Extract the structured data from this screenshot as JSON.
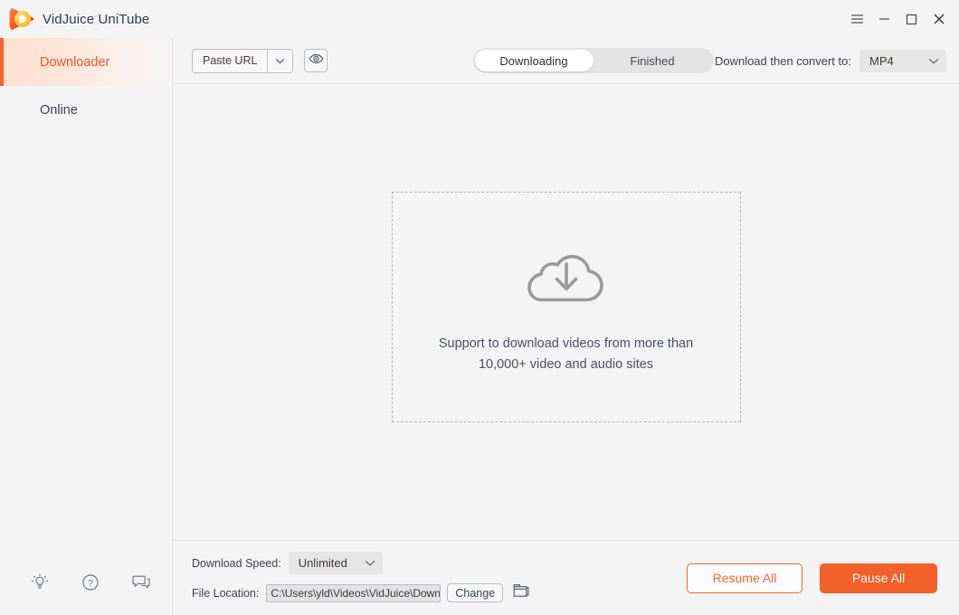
{
  "window": {
    "title": "VidJuice UniTube",
    "controls": [
      {
        "name": "menu-button",
        "glyph": "menu"
      },
      {
        "name": "minimize-button",
        "glyph": "minimize"
      },
      {
        "name": "maximize-button",
        "glyph": "maximize"
      },
      {
        "name": "close-button",
        "glyph": "close"
      }
    ]
  },
  "sidebar": {
    "items": [
      {
        "label": "Downloader",
        "active": true
      },
      {
        "label": "Online",
        "active": false
      }
    ],
    "bottom_icons": [
      {
        "name": "lightbulb-icon",
        "label": "Tips"
      },
      {
        "name": "question-circle-icon",
        "label": "Help"
      },
      {
        "name": "chat-bubbles-icon",
        "label": "Feedback"
      }
    ]
  },
  "toolbar": {
    "paste_url_label": "Paste URL",
    "paste_caret_name": "chevron-down-icon",
    "eye_button_name": "eye-icon",
    "tabs": [
      {
        "label": "Downloading",
        "active": true
      },
      {
        "label": "Finished",
        "active": false
      }
    ],
    "convert_label": "Download then convert to:",
    "convert_value": "MP4"
  },
  "content": {
    "empty_state": {
      "icon": "cloud-download-icon",
      "line1": "Support to download videos from more than",
      "line2": "10,000+ video and audio sites"
    }
  },
  "footer": {
    "speed_label": "Download Speed:",
    "speed_value": "Unlimited",
    "location_label": "File Location:",
    "location_value": "C:\\Users\\yld\\Videos\\VidJuice\\Downloaded",
    "change_label": "Change",
    "folder_icon_name": "folder-icon",
    "resume_label": "Resume All",
    "pause_label": "Pause All"
  },
  "colors": {
    "accent": "#f4602a",
    "accent_text": "#f4552a",
    "window_bg": "#f4f4f4",
    "border": "#e4e4e4",
    "text": "#3c4350",
    "muted": "#8c8c8c"
  }
}
